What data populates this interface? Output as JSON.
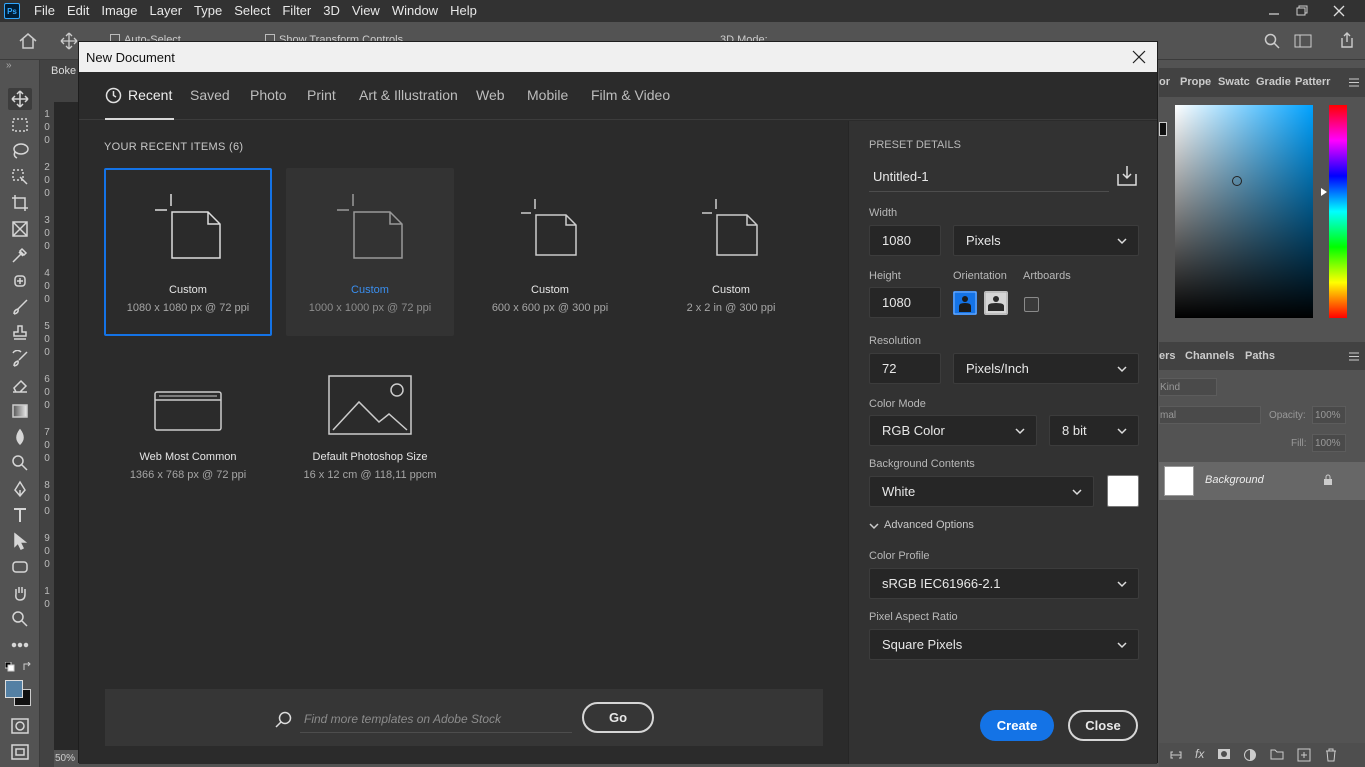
{
  "app": {
    "logo": "Ps",
    "menu": [
      "File",
      "Edit",
      "Image",
      "Layer",
      "Type",
      "Select",
      "Filter",
      "3D",
      "View",
      "Window",
      "Help"
    ]
  },
  "options_bar": {
    "auto_select": "Auto-Select",
    "show_transform": "Show Transform Controls",
    "mode_3d": "3D Mode:"
  },
  "document_tab": "Boke",
  "zoom": "50%",
  "ruler_numbers": [
    "1",
    "0",
    "0",
    "2",
    "0",
    "0",
    "3",
    "0",
    "0",
    "4",
    "0",
    "0",
    "5",
    "0",
    "0",
    "6",
    "0",
    "0",
    "7",
    "0",
    "0",
    "8",
    "0",
    "0",
    "9",
    "0",
    "0",
    "1",
    "0"
  ],
  "right_panels": {
    "tabs_top": [
      "or",
      "Prope",
      "Swatc",
      "Gradie",
      "Patterr"
    ],
    "tabs_layers": [
      "ers",
      "Channels",
      "Paths"
    ],
    "kind_label": "Kind",
    "mode_label": "mal",
    "opacity_label": "Opacity:",
    "opacity_value": "100%",
    "fill_label": "Fill:",
    "fill_value": "100%",
    "layer_name": "Background"
  },
  "dialog": {
    "title": "New Document",
    "tabs": [
      "Recent",
      "Saved",
      "Photo",
      "Print",
      "Art & Illustration",
      "Web",
      "Mobile",
      "Film & Video"
    ],
    "recent_heading": "YOUR RECENT ITEMS",
    "recent_count": "(6)",
    "items": [
      {
        "name": "Custom",
        "desc": "1080 x 1080 px @ 72 ppi"
      },
      {
        "name": "Custom",
        "desc": "1000 x 1000 px @ 72 ppi"
      },
      {
        "name": "Custom",
        "desc": "600 x 600 px @ 300 ppi"
      },
      {
        "name": "Custom",
        "desc": "2 x 2 in @ 300 ppi"
      },
      {
        "name": "Web Most Common",
        "desc": "1366 x 768 px @ 72 ppi"
      },
      {
        "name": "Default Photoshop Size",
        "desc": "16 x 12 cm @ 118,11 ppcm"
      }
    ],
    "search_placeholder": "Find more templates on Adobe Stock",
    "go_label": "Go",
    "preset": {
      "heading": "PRESET DETAILS",
      "name": "Untitled-1",
      "width_label": "Width",
      "width_value": "1080",
      "width_unit": "Pixels",
      "height_label": "Height",
      "height_value": "1080",
      "orientation_label": "Orientation",
      "artboards_label": "Artboards",
      "resolution_label": "Resolution",
      "resolution_value": "72",
      "resolution_unit": "Pixels/Inch",
      "color_mode_label": "Color Mode",
      "color_mode": "RGB Color",
      "bit_depth": "8 bit",
      "background_label": "Background Contents",
      "background": "White",
      "advanced_label": "Advanced Options",
      "profile_label": "Color Profile",
      "profile": "sRGB IEC61966-2.1",
      "aspect_label": "Pixel Aspect Ratio",
      "aspect": "Square Pixels",
      "create_label": "Create",
      "close_label": "Close"
    }
  },
  "colors": {
    "accent": "#1473e6",
    "dialog_bg": "#2b2b2b",
    "panel_bg": "#535353"
  }
}
